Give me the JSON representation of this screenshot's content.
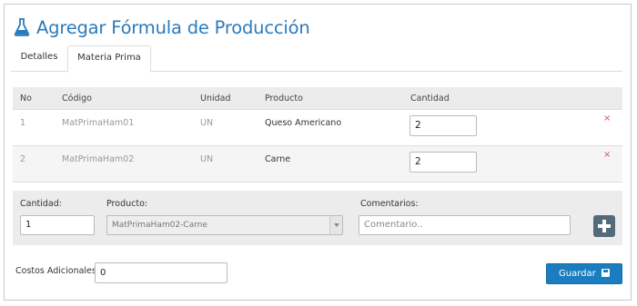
{
  "page": {
    "title": "Agregar Fórmula de Producción",
    "title_icon": "flask-icon"
  },
  "tabs": [
    {
      "label": "Detalles",
      "active": false
    },
    {
      "label": "Materia Prima",
      "active": true
    }
  ],
  "table": {
    "headers": {
      "no": "No",
      "codigo": "Código",
      "unidad": "Unidad",
      "producto": "Producto",
      "cantidad": "Cantidad"
    },
    "rows": [
      {
        "no": "1",
        "codigo": "MatPrimaHam01",
        "unidad": "UN",
        "producto": "Queso Americano",
        "cantidad": "2",
        "delete_icon": "×"
      },
      {
        "no": "2",
        "codigo": "MatPrimaHam02",
        "unidad": "UN",
        "producto": "Carne",
        "cantidad": "2",
        "delete_icon": "×"
      }
    ]
  },
  "add_form": {
    "cantidad_label": "Cantidad:",
    "cantidad_value": "1",
    "producto_label": "Producto:",
    "producto_selected": "MatPrimaHam02-Carne",
    "comentarios_label": "Comentarios:",
    "comentarios_placeholder": "Comentario..",
    "add_icon": "plus-square-icon"
  },
  "footer": {
    "costos_label": "Costos Adicionales:",
    "costos_value": "0",
    "save_label": "Guardar",
    "save_icon": "floppy-disk-icon"
  },
  "colors": {
    "accent": "#2a7bbd",
    "button": "#1a7dbf",
    "delete": "#d9534f",
    "add_button": "#526a7a"
  }
}
